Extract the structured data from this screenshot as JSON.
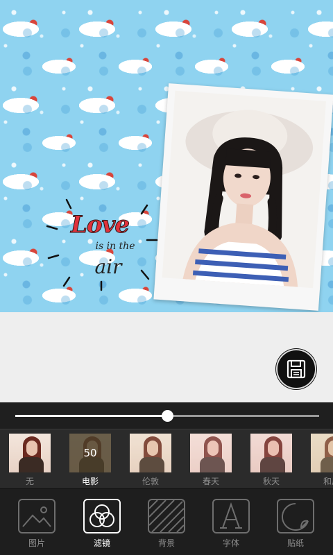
{
  "sticker": {
    "title": "Love",
    "subtitle": "is in the",
    "word": "air"
  },
  "slider": {
    "value_fraction": 0.5
  },
  "filters": [
    {
      "label": "无",
      "tint": "#00000000",
      "value": ""
    },
    {
      "label": "电影",
      "tint": "#5a4a2f99",
      "value": "50",
      "active": true
    },
    {
      "label": "伦敦",
      "tint": "#e8d2b033",
      "value": ""
    },
    {
      "label": "春天",
      "tint": "#f7c9d044",
      "value": ""
    },
    {
      "label": "秋天",
      "tint": "#f0b0b833",
      "value": ""
    },
    {
      "label": "和风",
      "tint": "#d8c89a55",
      "value": ""
    }
  ],
  "toolbar": {
    "photo_label": "图片",
    "filter_label": "滤镜",
    "background_label": "背景",
    "font_label": "字体",
    "sticker_label": "贴纸"
  },
  "colors": {
    "pattern_bg": "#8fd3f0",
    "love_red": "#e0323b",
    "toolbar_bg": "#1e1e1e"
  },
  "icons": {
    "save": "floppy-disk-icon",
    "photo": "image-icon",
    "filter": "three-circles-icon",
    "background": "diagonal-lines-icon",
    "font": "letter-a-icon",
    "sticker": "peeling-sticker-icon"
  }
}
